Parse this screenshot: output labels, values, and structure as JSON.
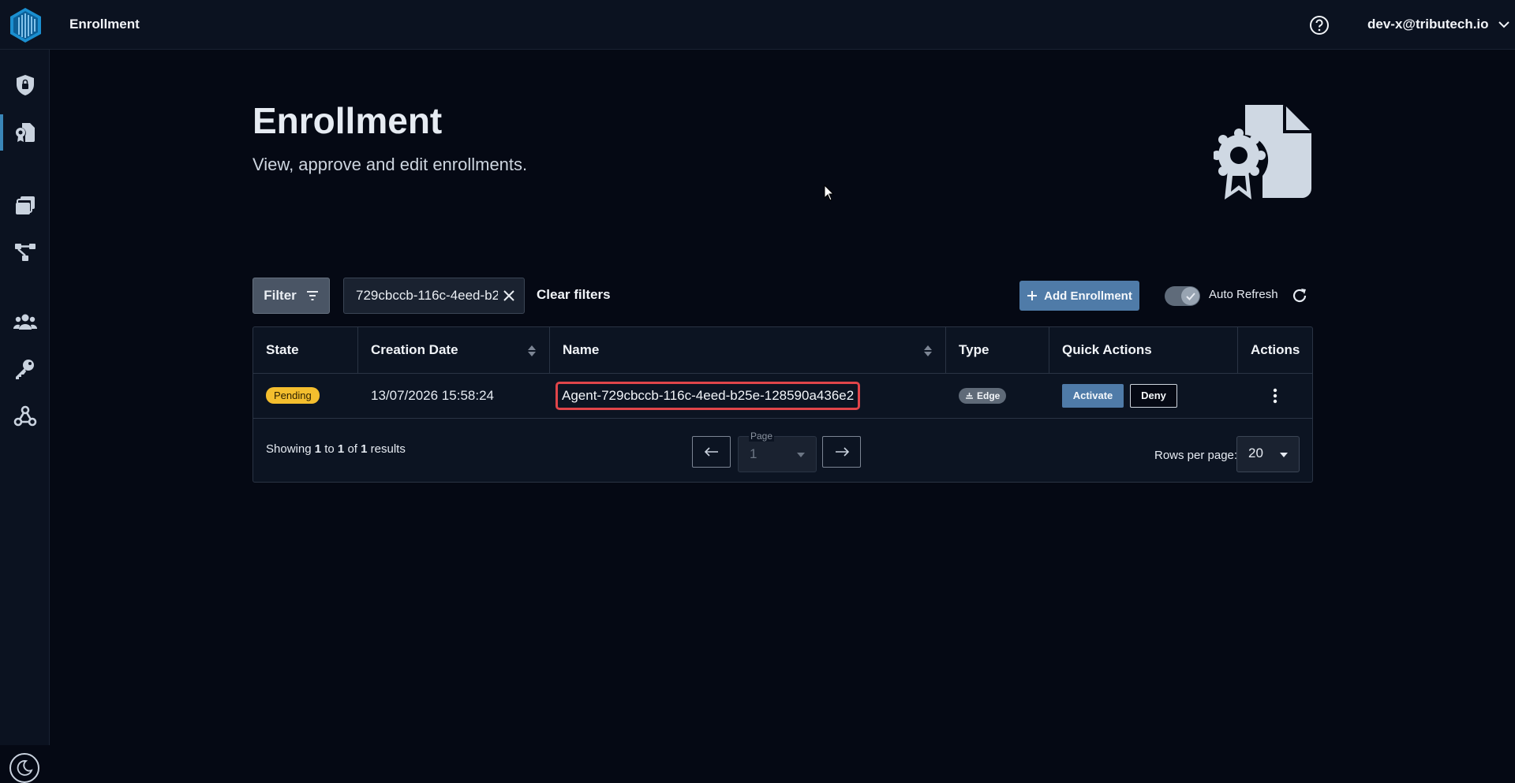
{
  "topbar": {
    "app_title": "Enrollment",
    "user": "dev-x@tributech.io",
    "icons": [
      "logo-icon",
      "help-icon",
      "chevron-down-icon"
    ]
  },
  "sidebar": {
    "items": [
      {
        "icon": "shield-lock-icon",
        "active": false
      },
      {
        "icon": "certificate-document-icon",
        "active": true
      },
      {
        "icon": "cards-icon",
        "active": false
      },
      {
        "icon": "network-nodes-icon",
        "active": false
      },
      {
        "icon": "users-icon",
        "active": false
      },
      {
        "icon": "key-icon",
        "active": false
      },
      {
        "icon": "webhook-icon",
        "active": false
      }
    ],
    "theme_icon": "moon-icon"
  },
  "header": {
    "title": "Enrollment",
    "subtitle": "View, approve and edit enrollments."
  },
  "toolbar": {
    "filter_label": "Filter",
    "filter_chip": "729cbccb-116c-4eed-b2",
    "clear_filters": "Clear filters",
    "add_label": "Add Enrollment",
    "auto_refresh_label": "Auto Refresh",
    "auto_refresh_on": true
  },
  "table": {
    "columns": [
      "State",
      "Creation Date",
      "Name",
      "Type",
      "Quick Actions",
      "Actions"
    ],
    "rows": [
      {
        "state": "Pending",
        "creation_date": "13/07/2026 15:58:24",
        "name": "Agent-729cbccb-116c-4eed-b25e-128590a436e2",
        "type": "Edge",
        "activate": "Activate",
        "deny": "Deny"
      }
    ]
  },
  "pagination": {
    "showing": "Showing",
    "from": "1",
    "to_word": "to",
    "to": "1",
    "of_word": "of",
    "total": "1",
    "results_word": "results",
    "page_label": "Page",
    "page_value": "1",
    "rows_per_page_label": "Rows per page:",
    "rows_per_page": "20"
  },
  "colors": {
    "background": "#050914",
    "panel": "#0b1220",
    "accent": "#4f7ba8",
    "pending": "#f4be2e",
    "highlight": "#e0454a"
  }
}
